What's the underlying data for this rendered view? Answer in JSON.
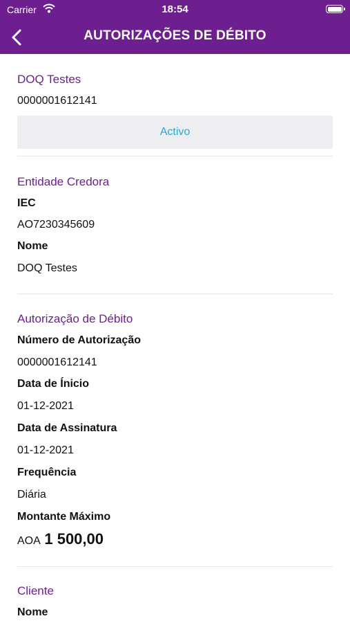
{
  "status_bar": {
    "carrier": "Carrier",
    "time": "18:54"
  },
  "nav": {
    "title": "AUTORIZAÇÕES DE DÉBITO"
  },
  "account": {
    "name": "DOQ Testes",
    "number": "0000001612141",
    "status": "Activo"
  },
  "creditor": {
    "title": "Entidade Credora",
    "iec_label": "IEC",
    "iec_value": "AO7230345609",
    "name_label": "Nome",
    "name_value": "DOQ Testes"
  },
  "authorization": {
    "title": "Autorização de Débito",
    "number_label": "Número de Autorização",
    "number_value": "0000001612141",
    "start_label": "Data de Ínicio",
    "start_value": "01-12-2021",
    "signature_label": "Data de Assinatura",
    "signature_value": "01-12-2021",
    "frequency_label": "Frequência",
    "frequency_value": "Diária",
    "max_label": "Montante Máximo",
    "currency": "AOA",
    "max_value": "1 500,00"
  },
  "client": {
    "title": "Cliente",
    "name_label": "Nome"
  },
  "colors": {
    "brand": "#6e1f8f",
    "status": "#29a7d9"
  }
}
